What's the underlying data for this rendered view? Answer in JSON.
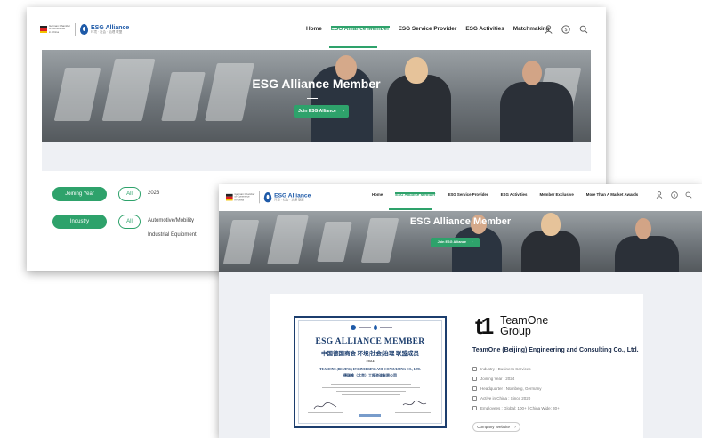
{
  "back_window": {
    "nav": {
      "menu": [
        "Home",
        "ESG Alliance Member",
        "ESG Service Provider",
        "ESG Activities",
        "Matchmaking"
      ],
      "active_index": 1
    },
    "hero": {
      "title": "ESG Alliance Member",
      "button_label": "Join ESG Alliance"
    },
    "filters": {
      "year_label": "Joining Year",
      "year_all": "All",
      "year_value": "2023",
      "industry_label": "Industry",
      "industry_all": "All",
      "industry_values": [
        "Automotive/Mobility",
        "Industrial Equipment"
      ]
    }
  },
  "front_window": {
    "nav": {
      "menu": [
        "Home",
        "ESG Alliance Member",
        "ESG Service Provider",
        "ESG Activities",
        "Member Exclusive",
        "More Than A Market Awards"
      ],
      "active_index": 1
    },
    "hero": {
      "title": "ESG Alliance Member",
      "button_label": "Join ESG Alliance"
    },
    "certificate": {
      "title_en": "ESG ALLIANCE MEMBER",
      "title_cn": "中国德国商会 环境|社会|治理 联盟成员",
      "year": "2024",
      "company_en": "TEAMONE (BEIJING) ENGINEERING AND CONSULTING CO., LTD.",
      "company_cn": "德瑞唯（北京）工程咨询有限公司"
    },
    "company_logo": {
      "mark": "t1",
      "line1": "TeamOne",
      "line2": "Group"
    },
    "company": {
      "name": "TeamOne (Beijing) Engineering and Consulting Co., Ltd.",
      "meta": [
        "Industry : Business Services",
        "Joining Year : 2024",
        "Headquarter : Nürnberg, Germany",
        "Active in China : Since 2020",
        "Employees : Global: 100+ | China Wide: 30+"
      ],
      "website_label": "Company Website"
    }
  },
  "brand_logo": {
    "esg_alliance": "ESG Alliance",
    "esg_alliance_cn": "环境 · 社会 · 治理 联盟"
  },
  "colors": {
    "accent": "#2ea26b",
    "brand_blue": "#1e5aa8",
    "navy": "#1c3e6e",
    "band": "#eef0f4"
  },
  "icons": [
    "user-icon",
    "globe-icon",
    "search-icon",
    "chevron-right-icon"
  ]
}
